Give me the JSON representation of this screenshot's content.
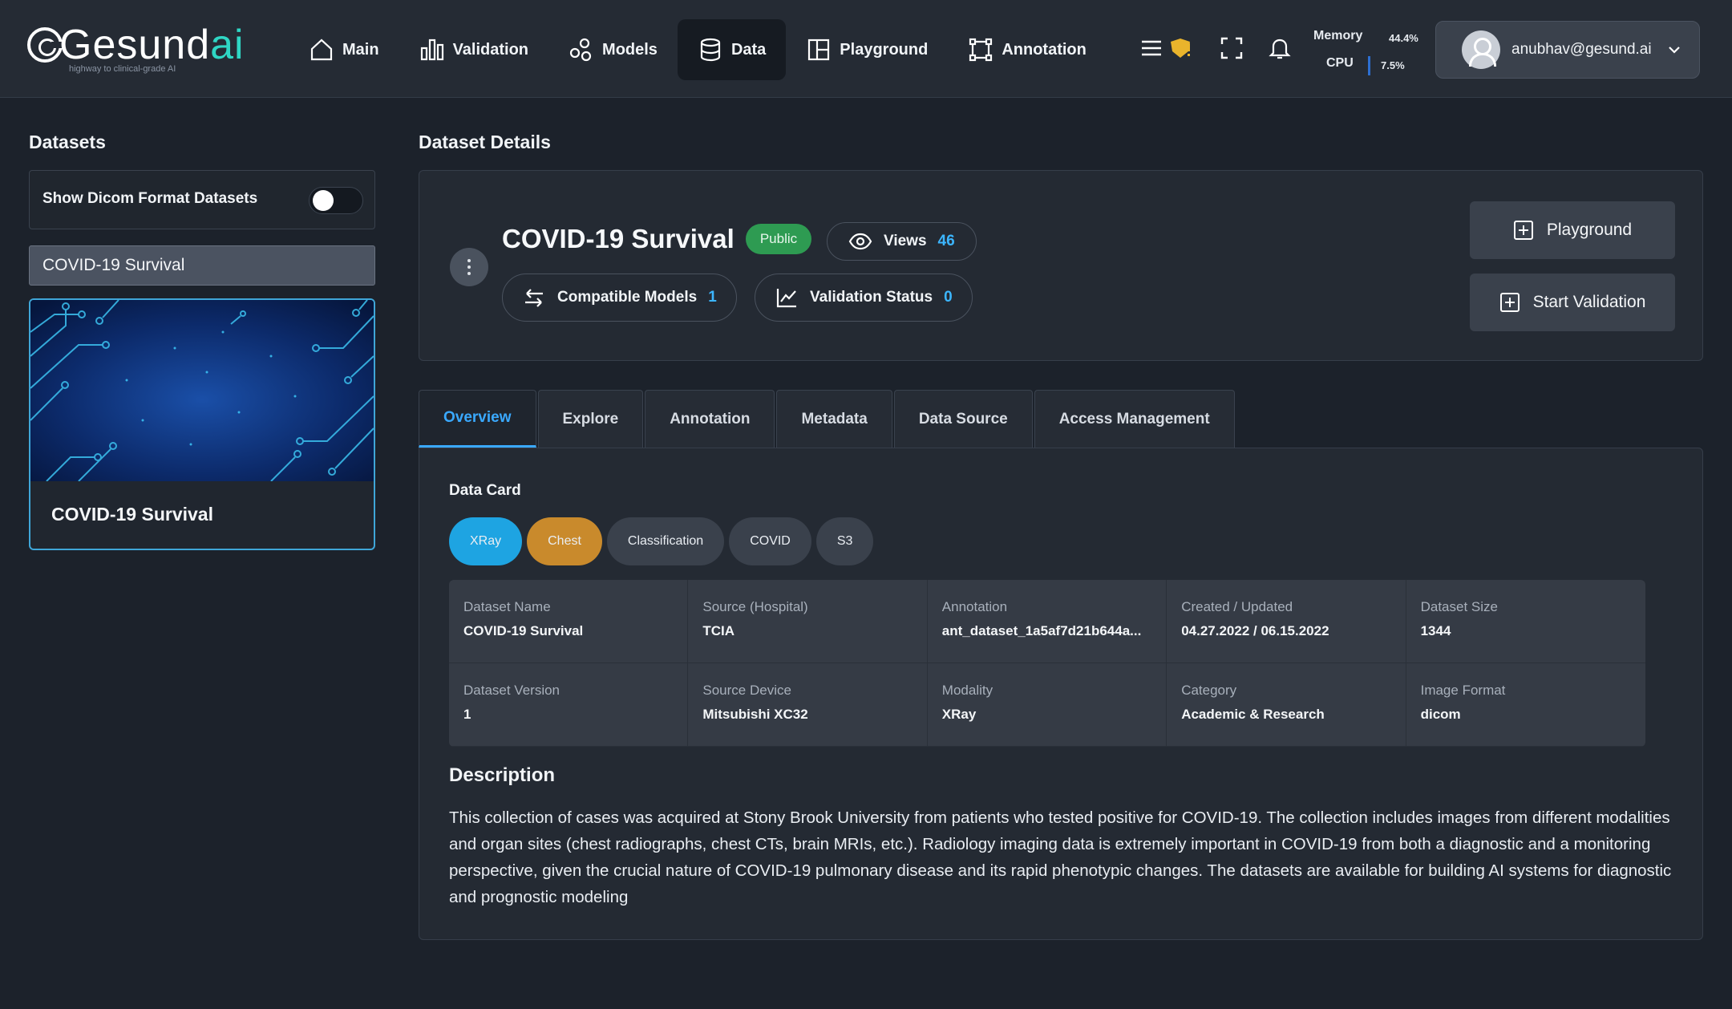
{
  "brand": {
    "name_main": "Gesund",
    "name_accent": "ai",
    "tagline": "highway to clinical-grade AI"
  },
  "nav": [
    {
      "label": "Main",
      "icon": "home-icon",
      "active": false
    },
    {
      "label": "Validation",
      "icon": "bar-chart-icon",
      "active": false
    },
    {
      "label": "Models",
      "icon": "models-icon",
      "active": false
    },
    {
      "label": "Data",
      "icon": "database-icon",
      "active": true
    },
    {
      "label": "Playground",
      "icon": "playground-icon",
      "active": false
    },
    {
      "label": "Annotation",
      "icon": "annotation-icon",
      "active": false
    }
  ],
  "toolbar": {
    "menu_icon": "menu-icon",
    "alert_icon": "shield-alert-icon",
    "fullscreen_icon": "fullscreen-icon",
    "bell_icon": "bell-icon"
  },
  "system": {
    "memory_label": "Memory",
    "memory_value": "44.4%",
    "cpu_label": "CPU",
    "cpu_value": "7.5%"
  },
  "user": {
    "email": "anubhav@gesund.ai"
  },
  "sidebar": {
    "title": "Datasets",
    "toggle_label": "Show Dicom Format Datasets",
    "toggle_on": false,
    "search_value": "COVID-19 Survival",
    "cards": [
      {
        "title": "COVID-19 Survival"
      }
    ]
  },
  "details": {
    "section_title": "Dataset Details",
    "title": "COVID-19 Survival",
    "visibility": "Public",
    "views_label": "Views",
    "views_count": "46",
    "compatible_label": "Compatible Models",
    "compatible_count": "1",
    "validation_label": "Validation Status",
    "validation_count": "0",
    "playground_button": "Playground",
    "start_validation_button": "Start Validation"
  },
  "tabs": [
    {
      "label": "Overview",
      "active": true
    },
    {
      "label": "Explore",
      "active": false
    },
    {
      "label": "Annotation",
      "active": false
    },
    {
      "label": "Metadata",
      "active": false
    },
    {
      "label": "Data Source",
      "active": false
    },
    {
      "label": "Access Management",
      "active": false
    }
  ],
  "data_card": {
    "title": "Data Card",
    "chips": [
      {
        "label": "XRay",
        "color": "#1ea4e2"
      },
      {
        "label": "Chest",
        "color": "#c98a2c"
      },
      {
        "label": "Classification",
        "color": "#3a414c"
      },
      {
        "label": "COVID",
        "color": "#3a414c"
      },
      {
        "label": "S3",
        "color": "#3a414c"
      }
    ],
    "fields": [
      {
        "key": "Dataset Name",
        "value": "COVID-19 Survival"
      },
      {
        "key": "Source (Hospital)",
        "value": "TCIA"
      },
      {
        "key": "Annotation",
        "value": "ant_dataset_1a5af7d21b644a..."
      },
      {
        "key": "Created / Updated",
        "value": "04.27.2022 / 06.15.2022"
      },
      {
        "key": "Dataset Size",
        "value": "1344"
      },
      {
        "key": "Dataset Version",
        "value": "1"
      },
      {
        "key": "Source Device",
        "value": "Mitsubishi XC32"
      },
      {
        "key": "Modality",
        "value": "XRay"
      },
      {
        "key": "Category",
        "value": "Academic & Research"
      },
      {
        "key": "Image Format",
        "value": "dicom"
      }
    ],
    "description_title": "Description",
    "description": "This collection of cases was acquired at Stony Brook University from patients who tested positive for COVID-19. The collection includes images from different modalities and organ sites (chest radiographs, chest CTs, brain MRIs, etc.). Radiology imaging data is extremely important in COVID-19 from both a diagnostic and a monitoring perspective, given the crucial nature of COVID-19 pulmonary disease and its rapid phenotypic changes. The datasets are available for building AI systems for diagnostic and prognostic modeling"
  }
}
